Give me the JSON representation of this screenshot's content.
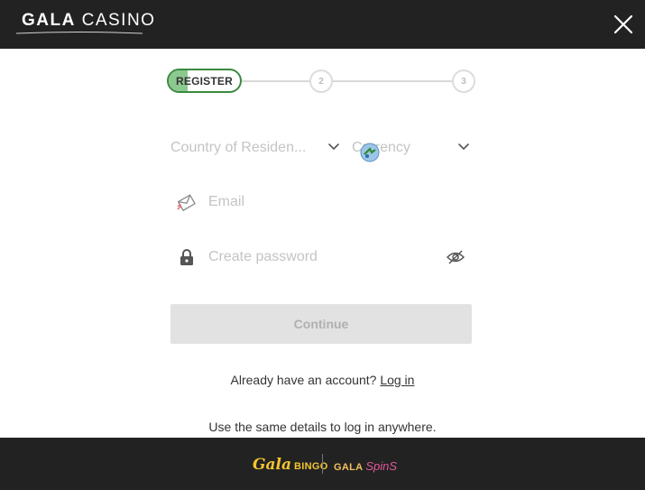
{
  "header": {
    "logo_left": "GALA",
    "logo_right": "CASINO",
    "close_icon": "close-icon"
  },
  "stepper": {
    "steps": [
      {
        "label": "REGISTER",
        "progress": 0.27
      },
      {
        "label": "2"
      },
      {
        "label": "3"
      }
    ],
    "colors": {
      "active_border": "#3a8a3f",
      "active_fill": "#8cc98f",
      "inactive": "#dcdcdc"
    }
  },
  "form": {
    "country": {
      "value": "Country of Residen...",
      "icon": "chevron-down-icon"
    },
    "currency": {
      "value": "Currency",
      "icon": "chevron-down-icon"
    },
    "email": {
      "placeholder": "Email",
      "icon": "envelope-icon"
    },
    "password": {
      "placeholder": "Create password",
      "icon": "lock-icon",
      "toggle_icon": "eye-hidden-icon"
    },
    "continue_label": "Continue"
  },
  "account": {
    "prompt": "Already have an account?",
    "login_link": "Log in"
  },
  "note": "Use the same details to log in anywhere.",
  "footer": {
    "bingo_a": "Gala",
    "bingo_b": "BINGO",
    "spins_a": "GALA",
    "spins_b": "SpinS"
  }
}
